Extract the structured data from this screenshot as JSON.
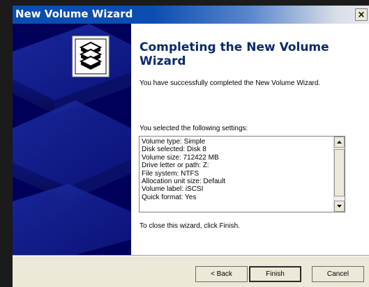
{
  "window": {
    "title": "New Volume Wizard",
    "close_label": "×"
  },
  "main": {
    "heading": "Completing the New Volume Wizard",
    "success_text": "You have successfully completed the New Volume Wizard.",
    "settings_label": "You selected the following settings:",
    "settings": [
      "Volume type: Simple",
      "Disk selected: Disk 8",
      "Volume size: 712422 MB",
      "Drive letter or path: Z:",
      "File system: NTFS",
      "Allocation unit size: Default",
      "Volume label: iSCSI",
      "Quick format: Yes"
    ],
    "close_text": "To close this wizard, click Finish."
  },
  "buttons": {
    "back": "< Back",
    "finish": "Finish",
    "cancel": "Cancel"
  },
  "colors": {
    "titlebar": "#0b4db0",
    "side_panel": "#00005a",
    "heading": "#0a2a6c"
  },
  "icons": {
    "wizard_logo": "stacked-disks-icon",
    "scroll_up": "scroll-up-arrow-icon",
    "scroll_down": "scroll-down-arrow-icon"
  }
}
